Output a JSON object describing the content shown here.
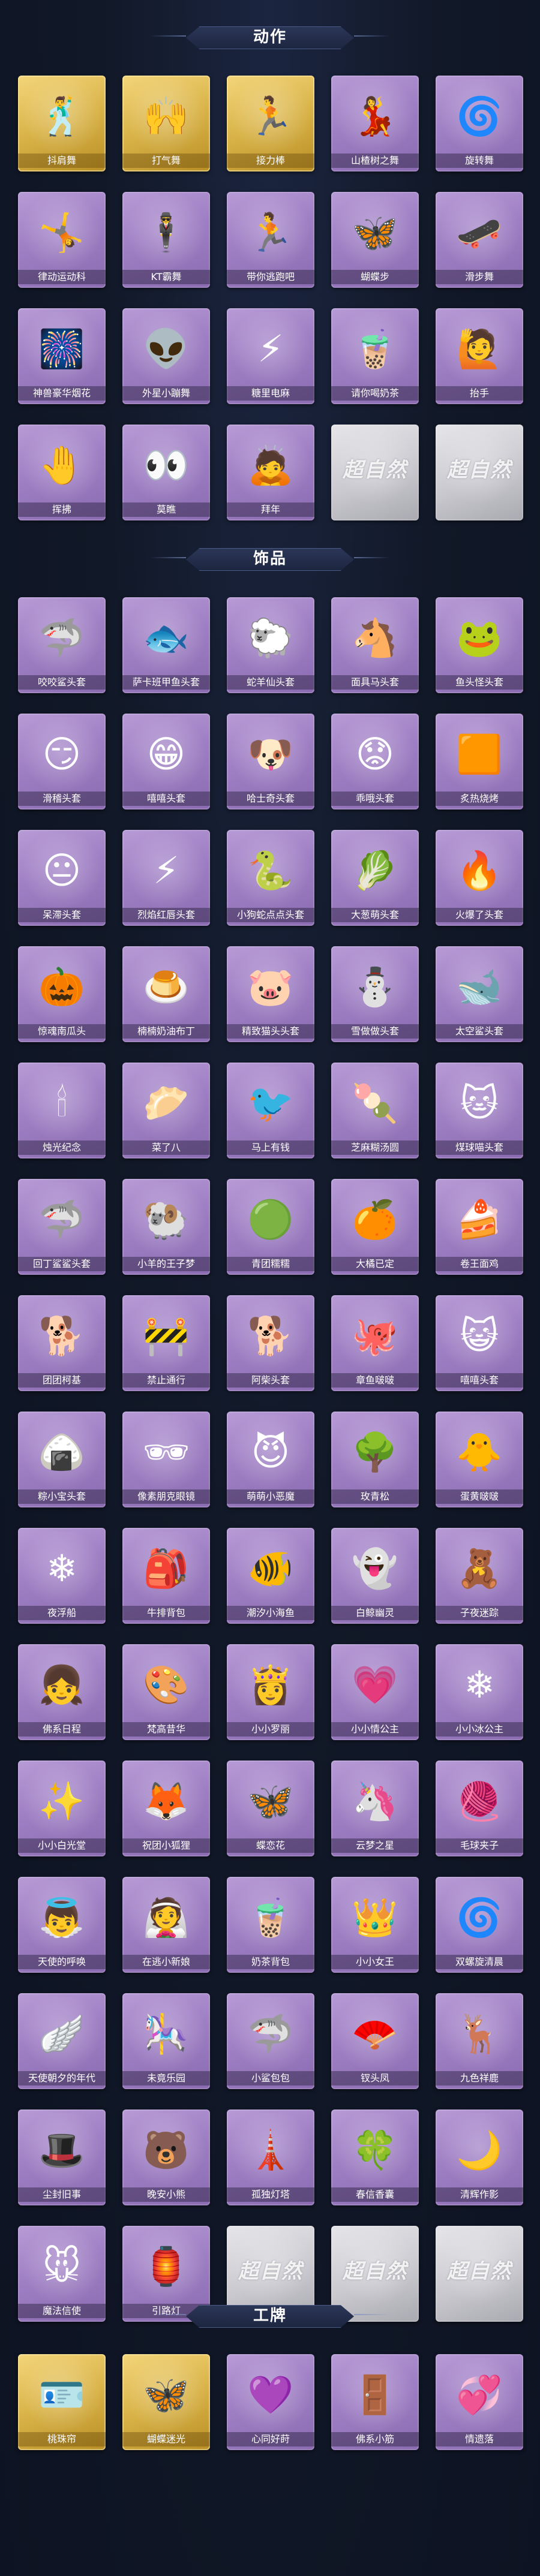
{
  "sections": [
    {
      "title": "动作",
      "items": [
        {
          "label": "抖肩舞",
          "icon": "dance-figure-icon",
          "glyph": "🕺",
          "tier": "gold"
        },
        {
          "label": "打气舞",
          "icon": "cheer-figure-icon",
          "glyph": "🙌",
          "tier": "gold"
        },
        {
          "label": "接力棒",
          "icon": "relay-figure-icon",
          "glyph": "🏃",
          "tier": "gold"
        },
        {
          "label": "山楂树之舞",
          "icon": "tree-dance-icon",
          "glyph": "💃",
          "tier": "purple"
        },
        {
          "label": "旋转舞",
          "icon": "spin-dance-icon",
          "glyph": "🌀",
          "tier": "purple"
        },
        {
          "label": "律动运动科",
          "icon": "rhythm-figure-icon",
          "glyph": "🤸",
          "tier": "purple"
        },
        {
          "label": "KT霸舞",
          "icon": "kt-dance-icon",
          "glyph": "🕴",
          "tier": "purple"
        },
        {
          "label": "带你逃跑吧",
          "icon": "run-away-icon",
          "glyph": "🏃",
          "tier": "purple"
        },
        {
          "label": "蝴蝶步",
          "icon": "butterfly-step-icon",
          "glyph": "🦋",
          "tier": "purple"
        },
        {
          "label": "滑步舞",
          "icon": "slide-dance-icon",
          "glyph": "🛹",
          "tier": "purple"
        },
        {
          "label": "神兽豪华烟花",
          "icon": "fireworks-icon",
          "glyph": "🎆",
          "tier": "purple"
        },
        {
          "label": "外星小蹦舞",
          "icon": "alien-dance-icon",
          "glyph": "👽",
          "tier": "purple"
        },
        {
          "label": "糖里电麻",
          "icon": "sugar-shock-icon",
          "glyph": "⚡",
          "tier": "purple"
        },
        {
          "label": "请你喝奶茶",
          "icon": "milk-tea-icon",
          "glyph": "🧋",
          "tier": "purple"
        },
        {
          "label": "抬手",
          "icon": "raise-hand-icon",
          "glyph": "🙋",
          "tier": "purple"
        },
        {
          "label": "挥拂",
          "icon": "wave-figure-icon",
          "glyph": "🤚",
          "tier": "purple"
        },
        {
          "label": "莫瞧",
          "icon": "peek-figure-icon",
          "glyph": "👀",
          "tier": "purple"
        },
        {
          "label": "拜年",
          "icon": "new-year-bow-icon",
          "glyph": "🙇",
          "tier": "purple"
        },
        {
          "label": "",
          "icon": "locked-placeholder-icon",
          "glyph": "",
          "tier": "locked"
        },
        {
          "label": "",
          "icon": "locked-placeholder-icon",
          "glyph": "",
          "tier": "locked"
        }
      ]
    },
    {
      "title": "饰品",
      "items": [
        {
          "label": "咬咬鲨头套",
          "icon": "shark-head-icon",
          "glyph": "🦈",
          "tier": "purple"
        },
        {
          "label": "萨卡班甲鱼头套",
          "icon": "fish-head-icon",
          "glyph": "🐟",
          "tier": "purple"
        },
        {
          "label": "蛇羊仙头套",
          "icon": "sheep-head-icon",
          "glyph": "🐑",
          "tier": "purple"
        },
        {
          "label": "面具马头套",
          "icon": "horse-head-icon",
          "glyph": "🐴",
          "tier": "purple"
        },
        {
          "label": "鱼头怪头套",
          "icon": "fish-monster-icon",
          "glyph": "🐸",
          "tier": "purple"
        },
        {
          "label": "滑稽头套",
          "icon": "smirk-face-icon",
          "glyph": "😏",
          "tier": "purple"
        },
        {
          "label": "嘻嘻头套",
          "icon": "grin-face-icon",
          "glyph": "😁",
          "tier": "purple"
        },
        {
          "label": "哈士奇头套",
          "icon": "husky-head-icon",
          "glyph": "🐶",
          "tier": "purple"
        },
        {
          "label": "乖哦头套",
          "icon": "worried-face-icon",
          "glyph": "😟",
          "tier": "purple"
        },
        {
          "label": "炙热烧烤",
          "icon": "grill-face-icon",
          "glyph": "🟧",
          "tier": "purple"
        },
        {
          "label": "呆滞头套",
          "icon": "dazed-face-icon",
          "glyph": "😐",
          "tier": "purple"
        },
        {
          "label": "烈焰红唇头套",
          "icon": "pikachu-head-icon",
          "glyph": "⚡",
          "tier": "purple"
        },
        {
          "label": "小狗蛇点点头套",
          "icon": "snake-dog-icon",
          "glyph": "🐍",
          "tier": "purple"
        },
        {
          "label": "大葱萌头套",
          "icon": "scallion-head-icon",
          "glyph": "🥬",
          "tier": "purple"
        },
        {
          "label": "火爆了头套",
          "icon": "fire-head-icon",
          "glyph": "🔥",
          "tier": "purple"
        },
        {
          "label": "惊魂南瓜头",
          "icon": "pumpkin-head-icon",
          "glyph": "🎃",
          "tier": "purple"
        },
        {
          "label": "楠楠奶油布丁",
          "icon": "pudding-head-icon",
          "glyph": "🍮",
          "tier": "purple"
        },
        {
          "label": "精致猫头头套",
          "icon": "pink-pig-icon",
          "glyph": "🐷",
          "tier": "purple"
        },
        {
          "label": "雪做做头套",
          "icon": "snowman-head-icon",
          "glyph": "⛄",
          "tier": "purple"
        },
        {
          "label": "太空鲨头套",
          "icon": "space-shark-icon",
          "glyph": "🐋",
          "tier": "purple"
        },
        {
          "label": "烛光纪念",
          "icon": "candle-head-icon",
          "glyph": "🕯",
          "tier": "purple"
        },
        {
          "label": "菜了八",
          "icon": "radish-head-icon",
          "glyph": "🥟",
          "tier": "purple"
        },
        {
          "label": "马上有钱",
          "icon": "lucky-bird-icon",
          "glyph": "🐦",
          "tier": "purple"
        },
        {
          "label": "芝麻糊汤圆",
          "icon": "rice-ball-icon",
          "glyph": "🍡",
          "tier": "purple"
        },
        {
          "label": "煤球喵头套",
          "icon": "black-cat-icon",
          "glyph": "🐱",
          "tier": "purple"
        },
        {
          "label": "回丁鲨鲨头套",
          "icon": "blue-shark-icon",
          "glyph": "🦈",
          "tier": "purple"
        },
        {
          "label": "小羊的王子梦",
          "icon": "lamb-prince-icon",
          "glyph": "🐏",
          "tier": "purple"
        },
        {
          "label": "青团糯糯",
          "icon": "green-dumpling-icon",
          "glyph": "🟢",
          "tier": "purple"
        },
        {
          "label": "大橘已定",
          "icon": "orange-face-icon",
          "glyph": "🍊",
          "tier": "purple"
        },
        {
          "label": "卷王面鸡",
          "icon": "roll-cake-icon",
          "glyph": "🍰",
          "tier": "purple"
        },
        {
          "label": "团团柯基",
          "icon": "corgi-head-icon",
          "glyph": "🐕",
          "tier": "purple"
        },
        {
          "label": "禁止通行",
          "icon": "traffic-cone-icon",
          "glyph": "🚧",
          "tier": "purple"
        },
        {
          "label": "阿柴头套",
          "icon": "shiba-head-icon",
          "glyph": "🐕",
          "tier": "purple"
        },
        {
          "label": "章鱼啵啵",
          "icon": "octopus-head-icon",
          "glyph": "🐙",
          "tier": "purple"
        },
        {
          "label": "嘻嘻头套",
          "icon": "tabby-cat-icon",
          "glyph": "😺",
          "tier": "purple"
        },
        {
          "label": "粽小宝头套",
          "icon": "zongzi-head-icon",
          "glyph": "🍙",
          "tier": "purple"
        },
        {
          "label": "像素朋克眼镜",
          "icon": "pixel-glasses-icon",
          "glyph": "🕶",
          "tier": "purple"
        },
        {
          "label": "萌萌小恶魔",
          "icon": "little-devil-icon",
          "glyph": "😈",
          "tier": "purple"
        },
        {
          "label": "玫青松",
          "icon": "bonsai-head-icon",
          "glyph": "🌳",
          "tier": "purple"
        },
        {
          "label": "蛋黄啵啵",
          "icon": "egg-yolk-icon",
          "glyph": "🐥",
          "tier": "purple"
        },
        {
          "label": "夜浮船",
          "icon": "snowflake-boat-icon",
          "glyph": "❄",
          "tier": "purple"
        },
        {
          "label": "牛排背包",
          "icon": "steak-backpack-icon",
          "glyph": "🎒",
          "tier": "purple"
        },
        {
          "label": "潮汐小海鱼",
          "icon": "sea-fish-icon",
          "glyph": "🐠",
          "tier": "purple"
        },
        {
          "label": "白鲸幽灵",
          "icon": "ghost-whale-icon",
          "glyph": "👻",
          "tier": "purple"
        },
        {
          "label": "子夜迷踪",
          "icon": "night-doll-icon",
          "glyph": "🧸",
          "tier": "purple"
        },
        {
          "label": "佛系日程",
          "icon": "pink-girl-icon",
          "glyph": "👧",
          "tier": "purple"
        },
        {
          "label": "梵高昔华",
          "icon": "painter-doll-icon",
          "glyph": "🎨",
          "tier": "purple"
        },
        {
          "label": "小小罗丽",
          "icon": "lolita-doll-icon",
          "glyph": "👸",
          "tier": "purple"
        },
        {
          "label": "小小情公主",
          "icon": "love-princess-icon",
          "glyph": "💗",
          "tier": "purple"
        },
        {
          "label": "小小冰公主",
          "icon": "ice-princess-icon",
          "glyph": "❄",
          "tier": "purple"
        },
        {
          "label": "小小白光堂",
          "icon": "light-doll-icon",
          "glyph": "✨",
          "tier": "purple"
        },
        {
          "label": "祝团小狐狸",
          "icon": "fox-doll-icon",
          "glyph": "🦊",
          "tier": "purple"
        },
        {
          "label": "蝶恋花",
          "icon": "butterfly-flower-icon",
          "glyph": "🦋",
          "tier": "purple"
        },
        {
          "label": "云梦之星",
          "icon": "unicorn-cloud-icon",
          "glyph": "🦄",
          "tier": "purple"
        },
        {
          "label": "毛球夹子",
          "icon": "furball-clip-icon",
          "glyph": "🧶",
          "tier": "purple"
        },
        {
          "label": "天使的呼唤",
          "icon": "angel-doll-icon",
          "glyph": "👼",
          "tier": "purple"
        },
        {
          "label": "在逃小新娘",
          "icon": "runaway-bride-icon",
          "glyph": "👰",
          "tier": "purple"
        },
        {
          "label": "奶茶背包",
          "icon": "milk-tea-bag-icon",
          "glyph": "🧋",
          "tier": "purple"
        },
        {
          "label": "小小女王",
          "icon": "little-queen-icon",
          "glyph": "👑",
          "tier": "purple"
        },
        {
          "label": "双螺旋清晨",
          "icon": "spiral-silver-icon",
          "glyph": "🌀",
          "tier": "purple"
        },
        {
          "label": "天使朝夕的年代",
          "icon": "winged-doll-icon",
          "glyph": "🪽",
          "tier": "purple"
        },
        {
          "label": "未竟乐园",
          "icon": "dream-doll-icon",
          "glyph": "🎠",
          "tier": "purple"
        },
        {
          "label": "小鲨包包",
          "icon": "shark-bag-icon",
          "glyph": "🦈",
          "tier": "purple"
        },
        {
          "label": "钗头凤",
          "icon": "phoenix-doll-icon",
          "glyph": "🪭",
          "tier": "purple"
        },
        {
          "label": "九色祥鹿",
          "icon": "nine-color-deer-icon",
          "glyph": "🦌",
          "tier": "purple"
        },
        {
          "label": "尘封旧事",
          "icon": "old-story-icon",
          "glyph": "🎩",
          "tier": "purple"
        },
        {
          "label": "晚安小熊",
          "icon": "night-bear-icon",
          "glyph": "🐻",
          "tier": "purple"
        },
        {
          "label": "孤独灯塔",
          "icon": "lighthouse-icon",
          "glyph": "🗼",
          "tier": "purple"
        },
        {
          "label": "春信香囊",
          "icon": "spring-pouch-icon",
          "glyph": "🍀",
          "tier": "purple"
        },
        {
          "label": "清辉作影",
          "icon": "moon-doll-icon",
          "glyph": "🌙",
          "tier": "purple"
        },
        {
          "label": "魔法信使",
          "icon": "magic-mouse-icon",
          "glyph": "🐭",
          "tier": "purple"
        },
        {
          "label": "引路灯",
          "icon": "guide-lantern-icon",
          "glyph": "🏮",
          "tier": "purple"
        },
        {
          "label": "",
          "icon": "locked-placeholder-icon",
          "glyph": "",
          "tier": "locked"
        },
        {
          "label": "",
          "icon": "locked-placeholder-icon",
          "glyph": "",
          "tier": "locked"
        },
        {
          "label": "",
          "icon": "locked-placeholder-icon",
          "glyph": "",
          "tier": "locked"
        }
      ]
    },
    {
      "title": "工牌",
      "items": [
        {
          "label": "桃珠帘",
          "icon": "badge-frame-icon",
          "glyph": "🪪",
          "tier": "gold"
        },
        {
          "label": "蝴蝶迷光",
          "icon": "butterfly-badge-icon",
          "glyph": "🦋",
          "tier": "gold"
        },
        {
          "label": "心同好莳",
          "icon": "heart-badge-icon",
          "glyph": "💜",
          "tier": "purple"
        },
        {
          "label": "佛系小筋",
          "icon": "zen-badge-icon",
          "glyph": "🚪",
          "tier": "purple"
        },
        {
          "label": "情遗落",
          "icon": "love-badge-icon",
          "glyph": "💞",
          "tier": "purple"
        }
      ]
    }
  ],
  "locked_watermark": "超自然"
}
